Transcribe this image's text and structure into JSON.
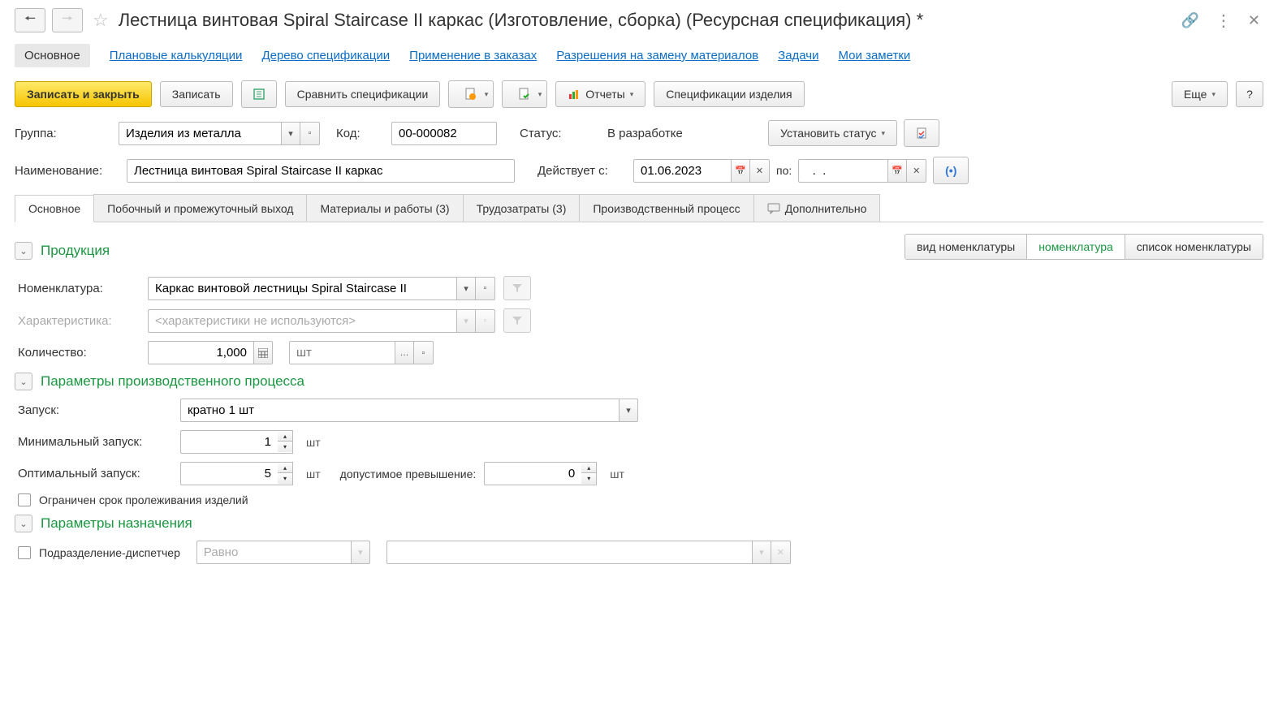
{
  "title": "Лестница винтовая Spiral Staircase II каркас (Изготовление, сборка) (Ресурсная спецификация) *",
  "subnav": {
    "main": "Основное",
    "plan": "Плановые калькуляции",
    "tree": "Дерево спецификации",
    "orders": "Применение в заказах",
    "perm": "Разрешения на замену материалов",
    "tasks": "Задачи",
    "notes": "Мои заметки"
  },
  "toolbar": {
    "save_close": "Записать и закрыть",
    "save": "Записать",
    "compare": "Сравнить спецификации",
    "reports": "Отчеты",
    "specs": "Спецификации изделия",
    "more": "Еще",
    "help": "?"
  },
  "form": {
    "group_label": "Группа:",
    "group_value": "Изделия из металла",
    "code_label": "Код:",
    "code_value": "00-000082",
    "status_label": "Статус:",
    "status_value": "В разработке",
    "set_status": "Установить статус",
    "name_label": "Наименование:",
    "name_value": "Лестница винтовая Spiral Staircase II каркас",
    "valid_from_label": "Действует с:",
    "valid_from": "01.06.2023",
    "to_label": "по:",
    "to_value": "  .  .    "
  },
  "tabs": {
    "main": "Основное",
    "byproduct": "Побочный и промежуточный выход",
    "materials": "Материалы и работы (3)",
    "labor": "Трудозатраты (3)",
    "process": "Производственный процесс",
    "extra": "Дополнительно"
  },
  "seg": {
    "kind": "вид номенклатуры",
    "nom": "номенклатура",
    "list": "список номенклатуры"
  },
  "sections": {
    "product": "Продукция",
    "process_params": "Параметры производственного процесса",
    "assign_params": "Параметры назначения"
  },
  "product": {
    "nom_label": "Номенклатура:",
    "nom_value": "Каркас винтовой лестницы Spiral Staircase II",
    "char_label": "Характеристика:",
    "char_placeholder": "<характеристики не используются>",
    "qty_label": "Количество:",
    "qty_value": "1,000",
    "unit_placeholder": "шт"
  },
  "process": {
    "launch_label": "Запуск:",
    "launch_value": "кратно 1 шт",
    "min_label": "Минимальный запуск:",
    "min_value": "1",
    "opt_label": "Оптимальный запуск:",
    "opt_value": "5",
    "excess_label": "допустимое превышение:",
    "excess_value": "0",
    "unit": "шт",
    "limited": "Ограничен срок пролеживания изделий"
  },
  "assign": {
    "dispatcher": "Подразделение-диспетчер",
    "equals": "Равно"
  }
}
